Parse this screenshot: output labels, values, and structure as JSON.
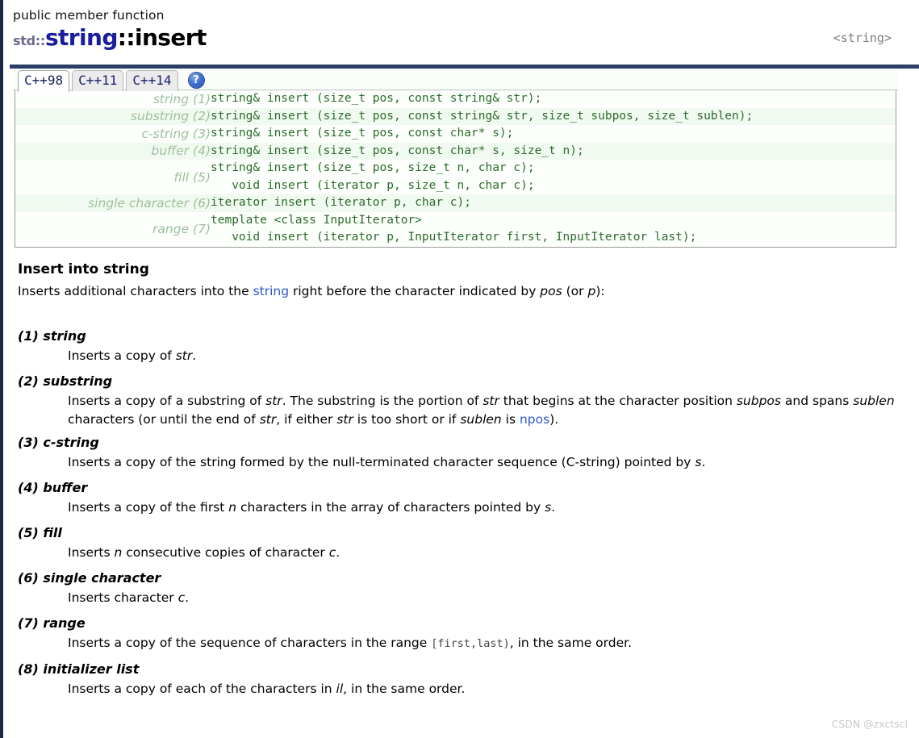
{
  "header": {
    "kind": "public member function",
    "title_std": "std::",
    "title_class": "string",
    "title_member": "::insert",
    "header_file": "<string>"
  },
  "tabs": {
    "items": [
      {
        "label": "C++98",
        "active": true
      },
      {
        "label": "C++11",
        "active": false
      },
      {
        "label": "C++14",
        "active": false
      }
    ],
    "help_icon": "?"
  },
  "prototypes": [
    {
      "label": "string (1)",
      "lines": [
        "string& insert (size_t pos, const string& str);"
      ],
      "stripe": "plain"
    },
    {
      "label": "substring (2)",
      "lines": [
        "string& insert (size_t pos, const string& str, size_t subpos, size_t sublen);"
      ],
      "stripe": "alt"
    },
    {
      "label": "c-string (3)",
      "lines": [
        "string& insert (size_t pos, const char* s);"
      ],
      "stripe": "plain"
    },
    {
      "label": "buffer (4)",
      "lines": [
        "string& insert (size_t pos, const char* s, size_t n);"
      ],
      "stripe": "alt"
    },
    {
      "label": "fill (5)",
      "lines": [
        "string& insert (size_t pos, size_t n, char c);",
        "   void insert (iterator p, size_t n, char c);"
      ],
      "stripe": "plain"
    },
    {
      "label": "single character (6)",
      "lines": [
        "iterator insert (iterator p, char c);"
      ],
      "stripe": "alt"
    },
    {
      "label": "range (7)",
      "lines": [
        "template <class InputIterator>",
        "   void insert (iterator p, InputIterator first, InputIterator last);"
      ],
      "stripe": "plain"
    }
  ],
  "section": {
    "heading": "Insert into string",
    "lead_1": "Inserts additional characters into the ",
    "lead_link": "string",
    "lead_2": " right before the character indicated by ",
    "lead_pos": "pos",
    "lead_3": " (or ",
    "lead_p": "p",
    "lead_4": "):"
  },
  "variants": [
    {
      "title": "(1) string",
      "desc": "Inserts a copy of str."
    },
    {
      "title": "(2) substring",
      "desc": "Inserts a copy of a substring of str. The substring is the portion of str that begins at the character position subpos and spans sublen characters (or until the end of str, if either str is too short or if sublen is npos)."
    },
    {
      "title": "(3) c-string",
      "desc": "Inserts a copy of the string formed by the null-terminated character sequence (C-string) pointed by s."
    },
    {
      "title": "(4) buffer",
      "desc": "Inserts a copy of the first n characters in the array of characters pointed by s."
    },
    {
      "title": "(5) fill",
      "desc": "Inserts n consecutive copies of character c."
    },
    {
      "title": "(6) single character",
      "desc": "Inserts character c."
    },
    {
      "title": "(7) range",
      "desc": "Inserts a copy of the sequence of characters in the range [first,last), in the same order."
    },
    {
      "title": "(8) initializer list",
      "desc": "Inserts a copy of each of the characters in il, in the same order."
    }
  ],
  "watermark": "CSDN @zxctscl",
  "colors": {
    "rule": "#2b3f66",
    "class_name": "#191d9e",
    "code": "#2b6b2b",
    "label": "#9dbf9c",
    "link": "#2b58c8",
    "stripe": "#f1faf0"
  }
}
